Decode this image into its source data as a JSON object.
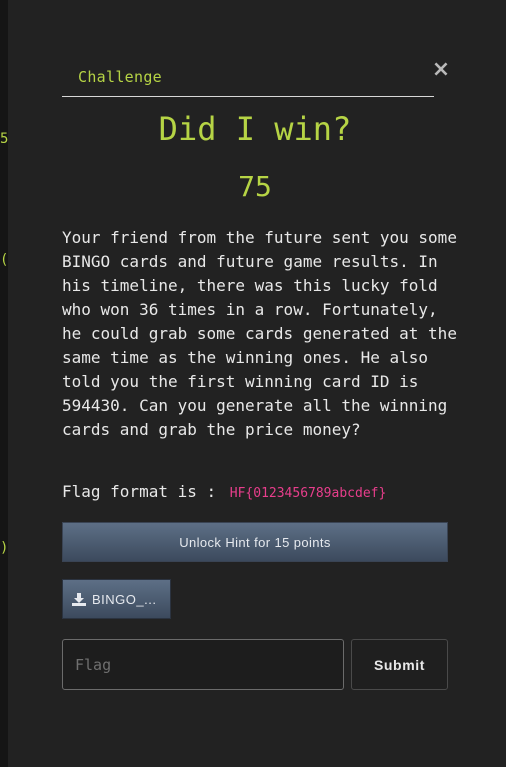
{
  "background": {
    "fragments": [
      "5",
      "(",
      ")"
    ]
  },
  "modal": {
    "tab_label": "Challenge",
    "close_glyph": "×",
    "title": "Did I win?",
    "points": "75",
    "description": "Your friend from the future sent you some BINGO cards and future game results. In his timeline, there was this lucky fold who won 36 times in a row. Fortunately, he could grab some cards generated at the same time as the winning ones. He also told you the first winning card ID is 594430. Can you generate all the winning cards and grab the price money?",
    "flag_format_label": "Flag format is :",
    "flag_format_value": "HF{0123456789abcdef}",
    "hint_button": "Unlock Hint for 15 points",
    "file_button": "BINGO_...",
    "file_icon": "download-icon",
    "flag_placeholder": "Flag",
    "submit_button": "Submit"
  },
  "colors": {
    "accent": "#b6d445",
    "flag_code": "#e83e8c",
    "button_blue": "#4c5c72",
    "background": "#222222"
  }
}
